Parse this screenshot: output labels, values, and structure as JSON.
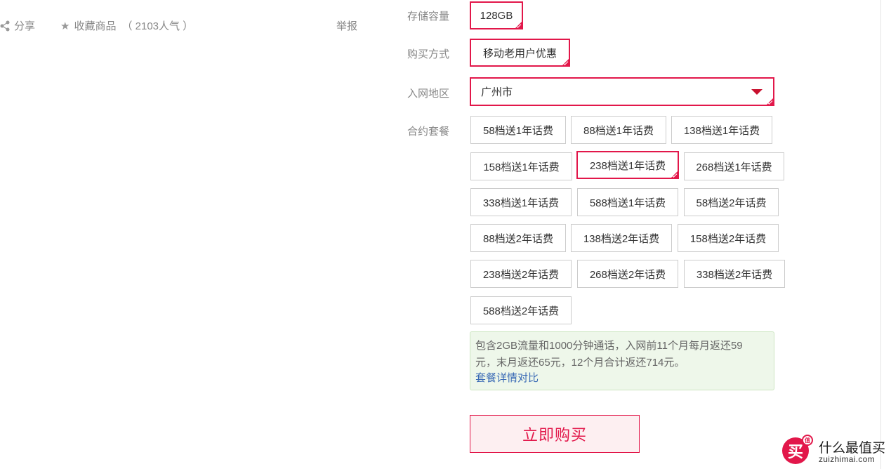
{
  "actions": {
    "share_label": "分享",
    "favorite_label": "收藏商品",
    "favorite_popularity": "（ 2103人气 ）",
    "report_label": "举报"
  },
  "storage": {
    "label": "存储容量",
    "options": [
      {
        "text": "128GB",
        "selected": true
      }
    ]
  },
  "purchase": {
    "label": "购买方式",
    "options": [
      {
        "text": "移动老用户优惠",
        "selected": true
      }
    ]
  },
  "region": {
    "label": "入网地区",
    "value": "广州市"
  },
  "plan": {
    "label": "合约套餐",
    "options": [
      {
        "text": "58档送1年话费",
        "selected": false
      },
      {
        "text": "88档送1年话费",
        "selected": false
      },
      {
        "text": "138档送1年话费",
        "selected": false
      },
      {
        "text": "158档送1年话费",
        "selected": false
      },
      {
        "text": "238档送1年话费",
        "selected": true
      },
      {
        "text": "268档送1年话费",
        "selected": false
      },
      {
        "text": "338档送1年话费",
        "selected": false
      },
      {
        "text": "588档送1年话费",
        "selected": false
      },
      {
        "text": "58档送2年话费",
        "selected": false
      },
      {
        "text": "88档送2年话费",
        "selected": false
      },
      {
        "text": "138档送2年话费",
        "selected": false
      },
      {
        "text": "158档送2年话费",
        "selected": false
      },
      {
        "text": "238档送2年话费",
        "selected": false
      },
      {
        "text": "268档送2年话费",
        "selected": false
      },
      {
        "text": "338档送2年话费",
        "selected": false
      },
      {
        "text": "588档送2年话费",
        "selected": false
      }
    ]
  },
  "plan_info": {
    "line1": "包含2GB流量和1000分钟通话，入网前11个月每月返还59",
    "line2": "元，末月返还65元，12个月合计返还714元。",
    "link": "套餐详情对比"
  },
  "buy_button": "立即购买",
  "brand": {
    "logo_char": "买",
    "badge": "值",
    "name": "什么最值买",
    "url": "zuizhimai.com"
  },
  "colors": {
    "accent": "#e2174a",
    "link": "#3a6ab5",
    "info_bg": "#eef7ea"
  }
}
